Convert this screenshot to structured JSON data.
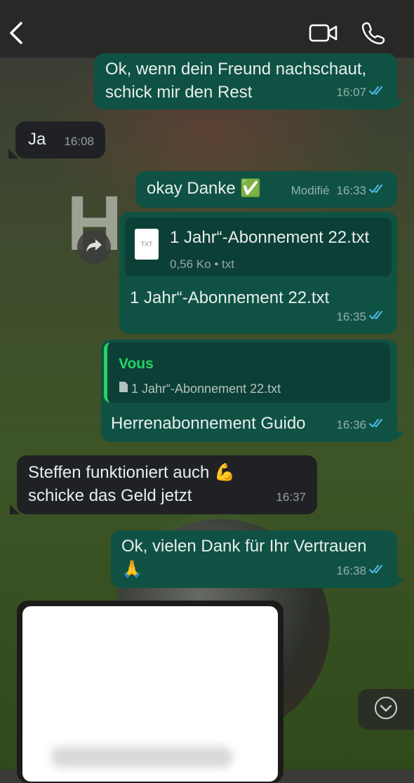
{
  "header": {
    "back_icon": "chevron-left-icon",
    "video_icon": "video-camera-icon",
    "phone_icon": "phone-icon"
  },
  "messages": [
    {
      "direction": "out",
      "text": "Ok, wenn dein Freund nachschaut,\nschick mir den Rest",
      "time": "16:07",
      "status": "read"
    },
    {
      "direction": "in",
      "text": "Ja",
      "time": "16:08"
    },
    {
      "direction": "out",
      "text": "okay Danke ✅",
      "edited_label": "Modifié",
      "time": "16:33",
      "status": "read"
    },
    {
      "direction": "out",
      "type": "file",
      "file_name": "1 Jahr“-Abonnement 22.txt",
      "file_meta": "0,56 Ko • txt",
      "file_icon_label": "TXT",
      "caption": "1 Jahr“-Abonnement 22.txt",
      "time": "16:35",
      "status": "read"
    },
    {
      "direction": "out",
      "type": "reply",
      "quote_author": "Vous",
      "quote_text": "1 Jahr“-Abonnement 22.txt",
      "text": "Herrenabonnement Guido",
      "time": "16:36",
      "status": "read"
    },
    {
      "direction": "in",
      "text": "Steffen funktioniert auch 💪\nschicke das Geld jetzt",
      "time": "16:37"
    },
    {
      "direction": "out",
      "text": "Ok, vielen Dank für Ihr Vertrauen\n🙏",
      "time": "16:38",
      "status": "read"
    }
  ],
  "colors": {
    "outgoing_bubble": "#0f5243",
    "incoming_bubble": "#1f2124",
    "read_checks": "#53bdeb",
    "quote_accent": "#25d366"
  }
}
